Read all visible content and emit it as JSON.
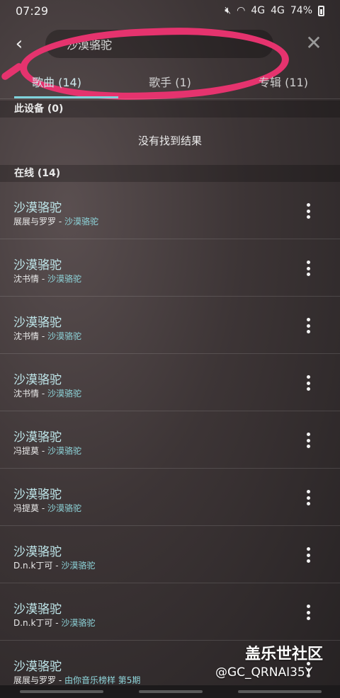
{
  "status_bar": {
    "time": "07:29",
    "signal_1": "4G",
    "signal_2": "4G",
    "battery_text": "74%"
  },
  "search": {
    "query": "沙漠骆驼"
  },
  "tabs": [
    {
      "label": "歌曲 (14)",
      "active": true
    },
    {
      "label": "歌手 (1)",
      "active": false
    },
    {
      "label": "专辑 (11)",
      "active": false
    }
  ],
  "device_section": {
    "header": "此设备 (0)",
    "empty_message": "没有找到结果"
  },
  "online_section": {
    "header": "在线 (14)"
  },
  "songs": [
    {
      "title": "沙漠骆驼",
      "artist": "展展与罗罗",
      "album": "沙漠骆驼"
    },
    {
      "title": "沙漠骆驼",
      "artist": "沈书情",
      "album": "沙漠骆驼"
    },
    {
      "title": "沙漠骆驼",
      "artist": "沈书情",
      "album": "沙漠骆驼"
    },
    {
      "title": "沙漠骆驼",
      "artist": "沈书情",
      "album": "沙漠骆驼"
    },
    {
      "title": "沙漠骆驼",
      "artist": "冯提莫",
      "album": "沙漠骆驼"
    },
    {
      "title": "沙漠骆驼",
      "artist": "冯提莫",
      "album": "沙漠骆驼"
    },
    {
      "title": "沙漠骆驼",
      "artist": "D.n.k丁可",
      "album": "沙漠骆驼"
    },
    {
      "title": "沙漠骆驼",
      "artist": "D.n.k丁可",
      "album": "沙漠骆驼"
    },
    {
      "title": "沙漠骆驼",
      "artist": "展展与罗罗",
      "album": "由你音乐榜样 第5期"
    }
  ],
  "watermark": {
    "title": "盖乐世社区",
    "user": "@GC_QRNAI35Y"
  },
  "colors": {
    "accent": "#7fd3dc",
    "annotation": "#e5336e"
  },
  "icons": {
    "back": "back-arrow-icon",
    "clear": "close-icon",
    "more": "more-vertical-icon"
  }
}
